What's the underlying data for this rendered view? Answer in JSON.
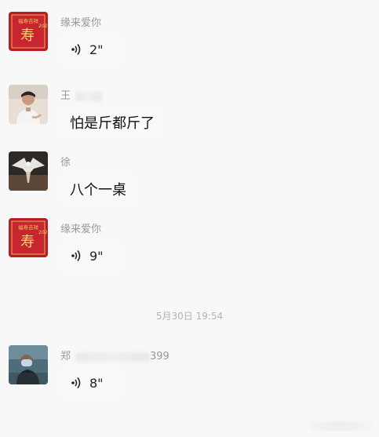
{
  "messages": [
    {
      "sender": "缘来爱你",
      "type": "voice",
      "duration": "2\"",
      "avatar": "red-greeting-card-avatar"
    },
    {
      "sender": "王",
      "type": "text",
      "text": "怕是斤都斤了",
      "avatar": "man-portrait-avatar"
    },
    {
      "sender": "徐",
      "type": "text",
      "text": "八个一桌",
      "avatar": "eagle-avatar"
    },
    {
      "sender": "缘来爱你",
      "type": "voice",
      "duration": "9\"",
      "avatar": "red-greeting-card-avatar"
    },
    {
      "sender": "郑",
      "sender_suffix": "399",
      "type": "voice",
      "duration": "8\"",
      "avatar": "man-in-car-avatar"
    }
  ],
  "timestamp": "5月30日 19:54",
  "colors": {
    "background": "#f8f8f8",
    "bubble": "#f9f9f9",
    "sender": "#9a9a9a",
    "timestamp": "#b3b3b3",
    "avatar_red": "#b81c24"
  }
}
